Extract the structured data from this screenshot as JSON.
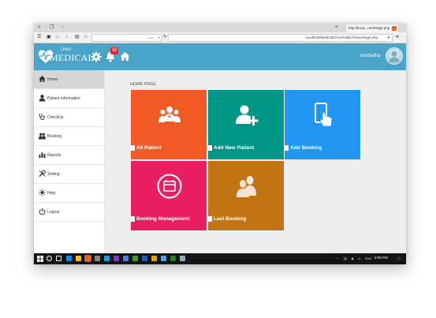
{
  "browser": {
    "tab_title": "http://local...omePage.php",
    "search_placeholder": "بحث",
    "url": "localhost/MedicalClinic/Public/HomePage.php",
    "controls": {
      "close": "×",
      "restore": "❐",
      "minimize": "−",
      "new_tab": "+"
    }
  },
  "header": {
    "logo_top": "clinic",
    "logo_main": "MEDICAL",
    "notification_count": "10",
    "username": "murtadha"
  },
  "sidebar": {
    "items": [
      {
        "label": "Home",
        "icon": "home-icon",
        "active": true
      },
      {
        "label": "Patient information",
        "icon": "user-icon"
      },
      {
        "label": "CheckUp",
        "icon": "stethoscope-icon"
      },
      {
        "label": "Booking",
        "icon": "people-icon"
      },
      {
        "label": "Reports",
        "icon": "chart-icon"
      },
      {
        "label": "Setting",
        "icon": "tools-icon"
      },
      {
        "label": "Help",
        "icon": "sun-icon"
      },
      {
        "label": "Logout",
        "icon": "power-icon"
      }
    ]
  },
  "main": {
    "page_title": "HOME PAGE",
    "tiles": [
      {
        "label": "All Patient",
        "color": "#f15a24",
        "icon": "doctors-group-icon"
      },
      {
        "label": "Add New Patient",
        "color": "#009688",
        "icon": "add-user-icon"
      },
      {
        "label": "Add Booking",
        "color": "#2196f3",
        "icon": "tablet-touch-icon"
      },
      {
        "label": "Booking Management",
        "color": "#e91e63",
        "icon": "calendar-icon"
      },
      {
        "label": "Last Booking",
        "color": "#c07414",
        "icon": "two-users-icon"
      }
    ]
  },
  "taskbar": {
    "language": "ENG",
    "time": "5:06 PM"
  },
  "colors": {
    "header": "#4aa3c8",
    "badge": "#e02b2b"
  }
}
